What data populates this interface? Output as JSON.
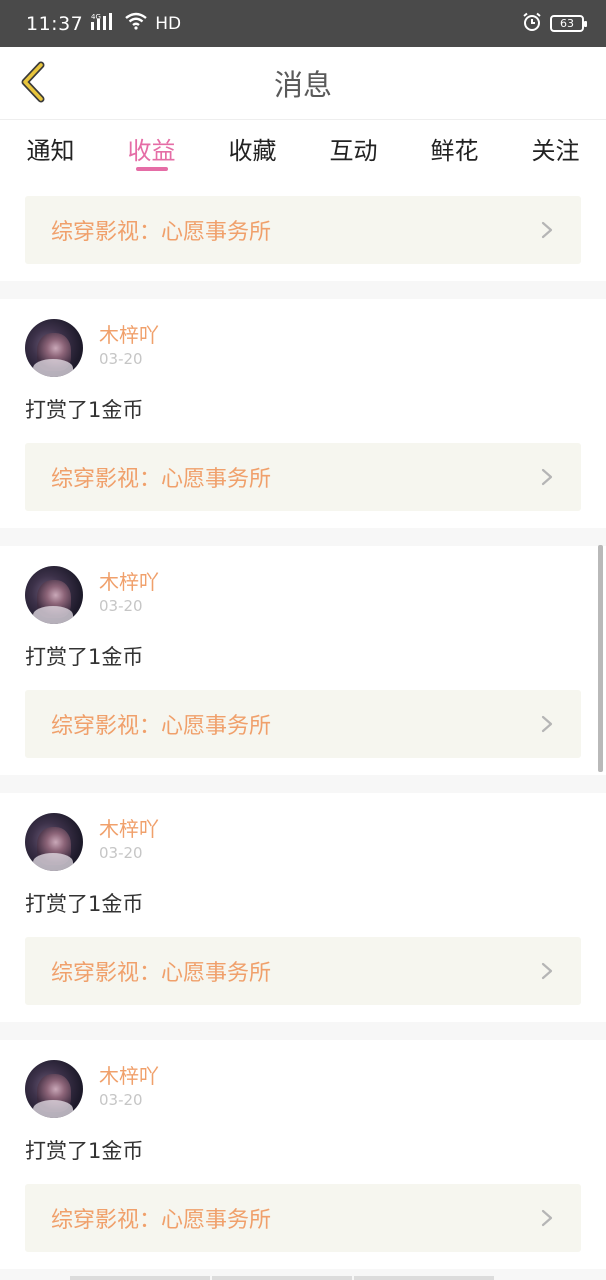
{
  "status_bar": {
    "time": "11:37",
    "network": "4G",
    "hd": "HD",
    "battery": "63"
  },
  "header": {
    "title": "消息"
  },
  "tabs": [
    {
      "label": "通知",
      "active": false
    },
    {
      "label": "收益",
      "active": true
    },
    {
      "label": "收藏",
      "active": false
    },
    {
      "label": "互动",
      "active": false
    },
    {
      "label": "鲜花",
      "active": false
    },
    {
      "label": "关注",
      "active": false
    }
  ],
  "partial_item": {
    "link_text": "综穿影视：心愿事务所"
  },
  "items": [
    {
      "username": "木梓吖",
      "date": "03-20",
      "action": "打赏了1金币",
      "link_text": "综穿影视：心愿事务所"
    },
    {
      "username": "木梓吖",
      "date": "03-20",
      "action": "打赏了1金币",
      "link_text": "综穿影视：心愿事务所"
    },
    {
      "username": "木梓吖",
      "date": "03-20",
      "action": "打赏了1金币",
      "link_text": "综穿影视：心愿事务所"
    },
    {
      "username": "木梓吖",
      "date": "03-20",
      "action": "打赏了1金币",
      "link_text": "综穿影视：心愿事务所"
    }
  ],
  "colors": {
    "accent_pink": "#e56da6",
    "accent_orange": "#f0a06b",
    "back_arrow": "#e8c53c"
  },
  "icons": {
    "back": "chevron-left-icon",
    "link": "chevron-right-icon"
  }
}
